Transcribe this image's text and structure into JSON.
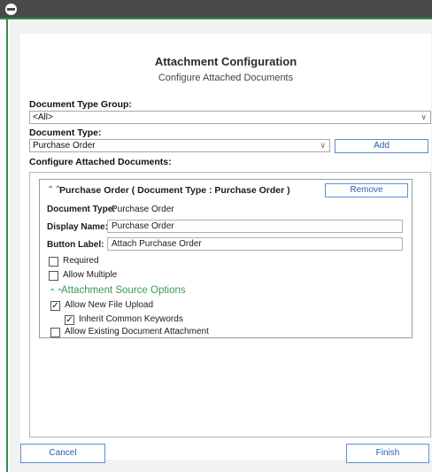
{
  "dialog": {
    "title": "Attachment Configuration",
    "subtitle": "Configure Attached Documents"
  },
  "document_type_group": {
    "label": "Document Type Group:",
    "value": "<All>"
  },
  "document_type": {
    "label": "Document Type:",
    "value": "Purchase Order",
    "add_label": "Add"
  },
  "configure": {
    "label": "Configure Attached Documents:"
  },
  "card": {
    "title": "Purchase Order ( Document Type : Purchase Order )",
    "remove_label": "Remove",
    "doc_type_label": "Document Type:",
    "doc_type_value": "Purchase Order",
    "display_name_label": "Display Name:",
    "display_name_value": "Purchase Order",
    "button_label_label": "Button Label:",
    "button_label_value": "Attach Purchase Order",
    "required_label": "Required",
    "required_checked": false,
    "allow_multiple_label": "Allow Multiple",
    "allow_multiple_checked": false,
    "source_options_title": "Attachment Source Options",
    "allow_new_upload_label": "Allow New File Upload",
    "allow_new_upload_checked": true,
    "inherit_keywords_label": "Inherit Common Keywords",
    "inherit_keywords_checked": true,
    "allow_existing_label": "Allow Existing Document Attachment",
    "allow_existing_checked": false
  },
  "footer": {
    "cancel_label": "Cancel",
    "finish_label": "Finish"
  },
  "icons": {
    "app_icon": "app-icon",
    "dropdown": "chevron-down-icon",
    "collapse": "double-chevron-up-icon",
    "check": "check-icon"
  },
  "colors": {
    "accent_green": "#3a9a55",
    "button_blue": "#2a5db0",
    "titlebar": "#4a4a4a"
  }
}
